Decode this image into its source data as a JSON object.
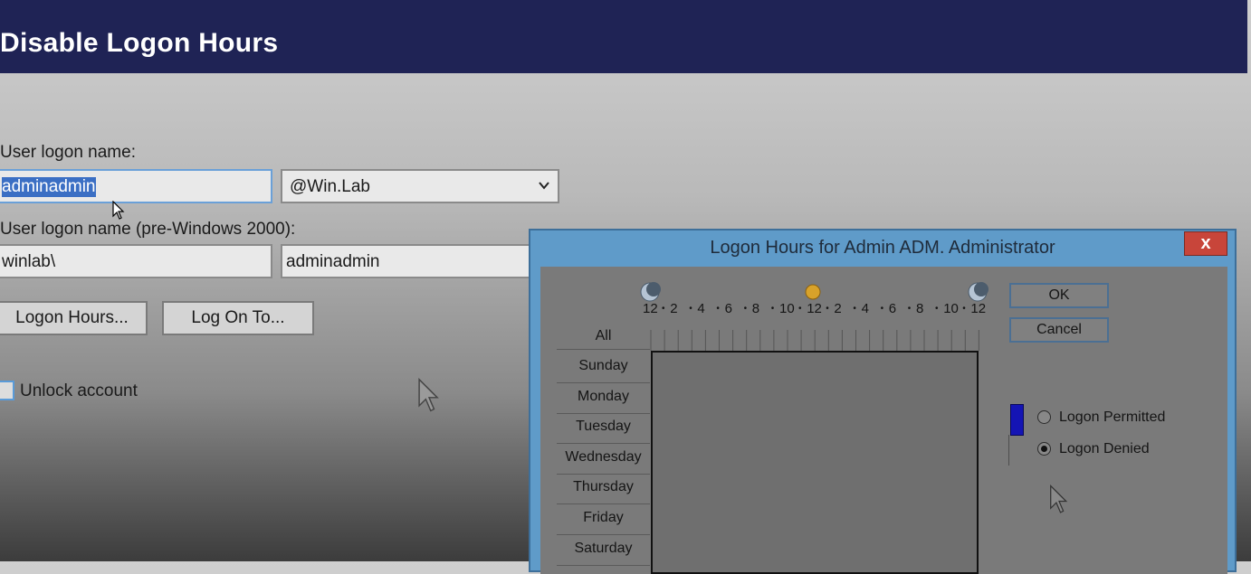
{
  "header": {
    "title": "Disable Logon Hours"
  },
  "form": {
    "logon_name_label": "User logon name:",
    "logon_name_value": "adminadmin",
    "domain_value": "@Win.Lab",
    "pre2000_label": "User logon name (pre-Windows 2000):",
    "pre2000_domain_value": "winlab\\",
    "pre2000_name_value": "adminadmin",
    "logon_hours_button": "Logon Hours...",
    "log_on_to_button": "Log On To...",
    "unlock_label": "Unlock account"
  },
  "dialog": {
    "title": "Logon Hours for Admin ADM. Administrator",
    "close_label": "x",
    "ok_label": "OK",
    "cancel_label": "Cancel",
    "hour_labels": [
      "12",
      "2",
      "4",
      "6",
      "8",
      "10",
      "12",
      "2",
      "4",
      "6",
      "8",
      "10",
      "12"
    ],
    "all_label": "All",
    "days": [
      "Sunday",
      "Monday",
      "Tuesday",
      "Wednesday",
      "Thursday",
      "Friday",
      "Saturday"
    ],
    "permitted_label": "Logon Permitted",
    "denied_label": "Logon Denied",
    "selected_option": "Logon Denied"
  },
  "colors": {
    "header_bg": "#1f2355",
    "dialog_frame": "#5f9bc9",
    "close_red": "#c8453a",
    "legend_blue": "#1414b4"
  }
}
